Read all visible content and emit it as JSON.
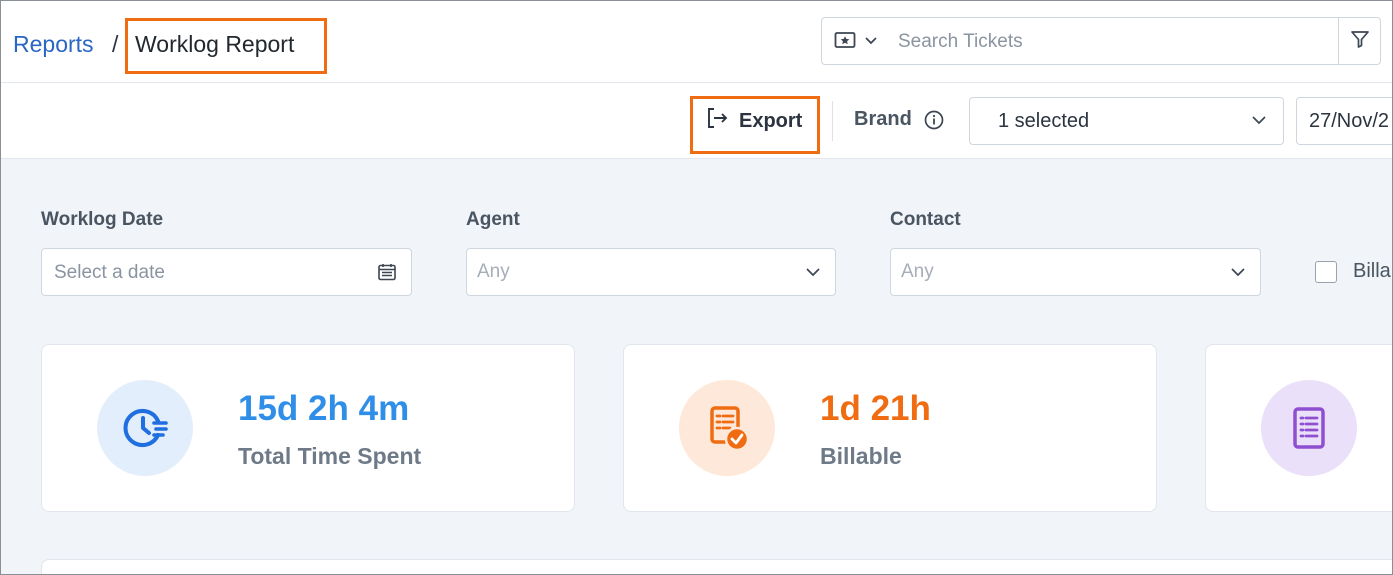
{
  "breadcrumb": {
    "parent": "Reports",
    "separator": "/",
    "current": "Worklog Report"
  },
  "search": {
    "placeholder": "Search Tickets",
    "type_icon": "ticket-icon",
    "filter_icon": "filter-icon"
  },
  "toolbar": {
    "export_label": "Export",
    "export_icon": "export-icon",
    "brand_label": "Brand",
    "brand_info_icon": "info-icon",
    "brand_value": "1 selected",
    "date_value": "27/Nov/2"
  },
  "filters": {
    "worklog_date": {
      "label": "Worklog Date",
      "placeholder": "Select a date",
      "icon": "calendar-icon"
    },
    "agent": {
      "label": "Agent",
      "value": "Any"
    },
    "contact": {
      "label": "Contact",
      "value": "Any"
    },
    "billable": {
      "label": "Billa",
      "checked": false
    }
  },
  "stats": [
    {
      "value": "15d 2h 4m",
      "caption": "Total Time Spent",
      "icon": "clock-icon",
      "color": "#2f8fe8",
      "bg": "#e3eefc"
    },
    {
      "value": "1d 21h",
      "caption": "Billable",
      "icon": "billable-document-icon",
      "color": "#ef6c12",
      "bg": "#fde8d9"
    },
    {
      "value": "",
      "caption": "",
      "icon": "notes-icon",
      "color": "#8e4fd0",
      "bg": "#ebe0f9"
    }
  ],
  "colors": {
    "link": "#2a66c4",
    "highlight": "#ef6c12",
    "content_bg": "#f1f4f8"
  }
}
